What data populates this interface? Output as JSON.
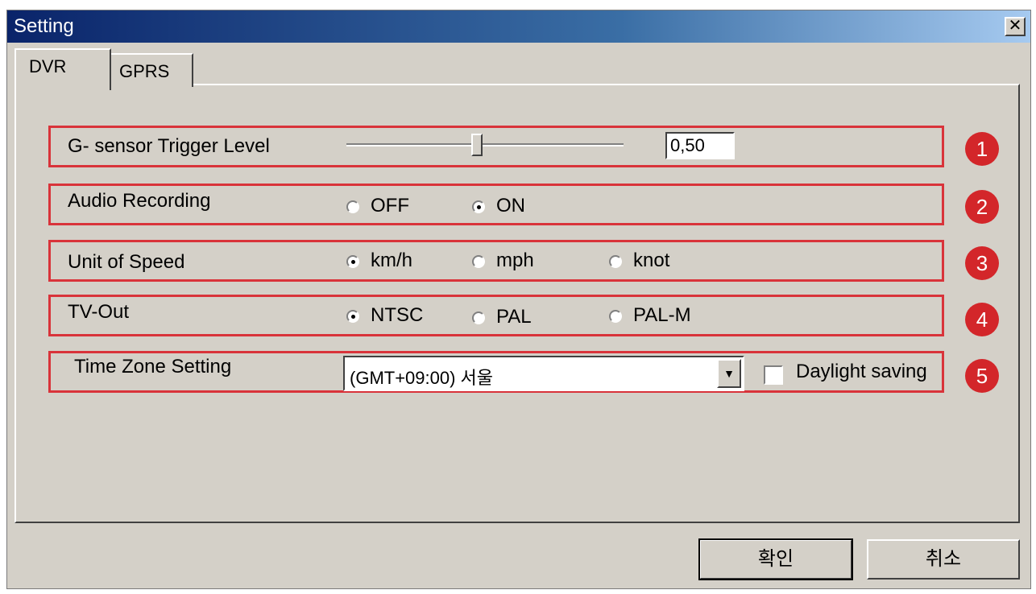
{
  "window": {
    "title": "Setting",
    "close_glyph": "✕"
  },
  "tabs": [
    {
      "label": "DVR",
      "active": true
    },
    {
      "label": "GPRS",
      "active": false
    }
  ],
  "gsensor": {
    "label": "G- sensor Trigger Level",
    "value": "0,50",
    "slider_fraction": 0.47,
    "badge": "1"
  },
  "audio": {
    "label": "Audio Recording",
    "options": [
      "OFF",
      "ON"
    ],
    "selected": "ON",
    "badge": "2"
  },
  "speed": {
    "label": "Unit of Speed",
    "options": [
      "km/h",
      "mph",
      "knot"
    ],
    "selected": "km/h",
    "badge": "3"
  },
  "tvout": {
    "label": "TV-Out",
    "options": [
      "NTSC",
      "PAL",
      "PAL-M"
    ],
    "selected": "NTSC",
    "badge": "4"
  },
  "timezone": {
    "label": "Time Zone Setting",
    "value": "(GMT+09:00) 서울",
    "daylight_label": "Daylight saving",
    "daylight_checked": false,
    "badge": "5"
  },
  "buttons": {
    "ok": "확인",
    "cancel": "취소"
  },
  "colors": {
    "highlight": "#d9333a",
    "badge": "#d3262a",
    "dialog_bg": "#d4d0c8"
  },
  "icons": {
    "close": "close-icon",
    "dropdown": "chevron-down-icon"
  }
}
